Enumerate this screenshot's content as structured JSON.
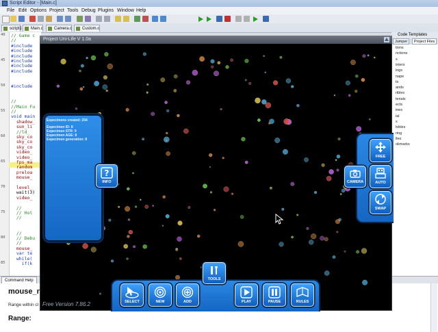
{
  "editor": {
    "title": "Script Editor - [Main.c]",
    "menu": [
      "File",
      "Edit",
      "Options",
      "Project",
      "Tools",
      "Debug",
      "Plugins",
      "Window",
      "Help"
    ],
    "tabs": [
      "script1",
      "Main.c",
      "Camera.c",
      "Custom.c"
    ],
    "code_lines": [
      {
        "n": "40",
        "text": "// Game c",
        "cls": "c-comment"
      },
      {
        "n": "",
        "text": "//",
        "cls": "c-comment"
      },
      {
        "n": "",
        "text": "#include",
        "cls": "c-keyword"
      },
      {
        "n": "",
        "text": "#include",
        "cls": "c-keyword"
      },
      {
        "n": "",
        "text": "#include",
        "cls": "c-keyword"
      },
      {
        "n": "45",
        "text": "#include",
        "cls": "c-keyword"
      },
      {
        "n": "",
        "text": "#include",
        "cls": "c-keyword"
      },
      {
        "n": "",
        "text": "#include",
        "cls": "c-keyword"
      },
      {
        "n": "",
        "text": "",
        "cls": ""
      },
      {
        "n": "",
        "text": "",
        "cls": ""
      },
      {
        "n": "50",
        "text": "#include",
        "cls": "c-keyword"
      },
      {
        "n": "",
        "text": "",
        "cls": ""
      },
      {
        "n": "",
        "text": "",
        "cls": ""
      },
      {
        "n": "",
        "text": "//",
        "cls": "c-comment"
      },
      {
        "n": "",
        "text": "//Main Fu",
        "cls": "c-comment"
      },
      {
        "n": "55",
        "text": "//",
        "cls": "c-comment"
      },
      {
        "n": "",
        "text": "void main",
        "cls": "c-keyword"
      },
      {
        "n": "",
        "text": "  shadow_",
        "cls": "c-red"
      },
      {
        "n": "",
        "text": "  sun_li",
        "cls": "c-red"
      },
      {
        "n": "",
        "text": "  //ld_",
        "cls": "c-comment"
      },
      {
        "n": "60",
        "text": "  sky_co",
        "cls": "c-red"
      },
      {
        "n": "",
        "text": "  sky_co",
        "cls": "c-red"
      },
      {
        "n": "",
        "text": "  sky_co",
        "cls": "c-red"
      },
      {
        "n": "",
        "text": "  video_",
        "cls": "c-red"
      },
      {
        "n": "",
        "text": "  video_",
        "cls": "c-red"
      },
      {
        "n": "65",
        "text": "  fps_ma",
        "cls": "c-red"
      },
      {
        "n": "",
        "text": "  random",
        "cls": "c-red"
      },
      {
        "n": "",
        "text": "  preloa",
        "cls": "c-red"
      },
      {
        "n": "",
        "text": "  mouse_",
        "cls": "c-red"
      },
      {
        "n": "",
        "text": "",
        "cls": ""
      },
      {
        "n": "70",
        "text": "  level_",
        "cls": "c-red"
      },
      {
        "n": "",
        "text": "  wait(3)",
        "cls": ""
      },
      {
        "n": "",
        "text": "  video_",
        "cls": "c-red"
      },
      {
        "n": "",
        "text": "",
        "cls": ""
      },
      {
        "n": "",
        "text": "  //",
        "cls": "c-comment"
      },
      {
        "n": "75",
        "text": "  // Hot",
        "cls": "c-comment"
      },
      {
        "n": "",
        "text": "  //",
        "cls": "c-comment"
      },
      {
        "n": "",
        "text": "",
        "cls": ""
      },
      {
        "n": "",
        "text": "",
        "cls": ""
      },
      {
        "n": "",
        "text": "  //",
        "cls": "c-comment"
      },
      {
        "n": "80",
        "text": "  // Debu",
        "cls": "c-comment"
      },
      {
        "n": "",
        "text": "  //",
        "cls": "c-comment"
      },
      {
        "n": "",
        "text": "  mouse_",
        "cls": "c-red"
      },
      {
        "n": "",
        "text": "  var te",
        "cls": "c-keyword"
      },
      {
        "n": "",
        "text": "  while(",
        "cls": "c-keyword"
      },
      {
        "n": "85",
        "text": "    if(k",
        "cls": "c-keyword"
      },
      {
        "n": "",
        "text": "",
        "cls": ""
      },
      {
        "n": "",
        "text": "",
        "cls": ""
      },
      {
        "n": "",
        "text": "    if(k",
        "cls": "c-keyword"
      }
    ],
    "right_panel": {
      "header": "Code Templates",
      "tabs": [
        "Jumper",
        "Project Files"
      ],
      "items": [
        "tions",
        "nctions",
        "s",
        "inters",
        "ings",
        "nape",
        "ts",
        "ands",
        "ribles",
        "terials",
        "ects",
        "ines",
        "ial",
        "s",
        "lobles",
        "ring",
        "lles",
        "okmarks"
      ]
    },
    "help": {
      "tab": "Command Help",
      "heading": "mouse_ra",
      "description": "Range within cl",
      "range_label": "Range:"
    }
  },
  "game": {
    "window_title": "Project Uni-Life V 1.0a",
    "info": {
      "created_label": "Especimens created: 204",
      "id_label": "Especimen ID: 8",
      "str_label": "Especimen STR: 9",
      "age_label": "Especimen AGE: 8",
      "gen_label": "Especimen generation: 8"
    },
    "buttons": {
      "info": "INFO",
      "camera": "CAMERA",
      "free": "FREE",
      "auto": "AUTO",
      "swap": "SWAP",
      "tools": "TOOLS",
      "select": "SELECT",
      "new": "NEW",
      "add": "ADD",
      "play": "PLAY",
      "pause": "PAUSE",
      "rules": "RULES"
    },
    "version": "Free Version 7.86.2",
    "colors": {
      "panel_blue": "#1d78d8",
      "particle_colors": [
        "#6fdc4a",
        "#e0c64a",
        "#d84a4a",
        "#c060e0",
        "#4ab0e0",
        "#e08a3a"
      ]
    }
  }
}
